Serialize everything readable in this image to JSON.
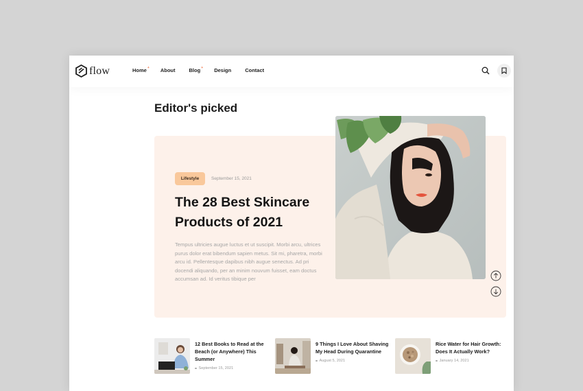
{
  "brand": {
    "name": "flow"
  },
  "nav": {
    "items": [
      {
        "label": "Home",
        "sup": "+"
      },
      {
        "label": "About",
        "sup": ""
      },
      {
        "label": "Blog",
        "sup": "+"
      },
      {
        "label": "Design",
        "sup": ""
      },
      {
        "label": "Contact",
        "sup": ""
      }
    ]
  },
  "section": {
    "title": "Editor's picked"
  },
  "hero": {
    "category": "Lifestyle",
    "date": "September 15, 2021",
    "title": "The 28 Best Skincare Products of 2021",
    "excerpt": "Tempus ultricies augue luctus et ut suscipit. Morbi arcu, ultrices purus dolor erat bibendum sapien metus. Sit mi, pharetra, morbi arcu id. Pellentesque dapibus nibh augue senectus. Ad pri docendi aliquando, per an minim nouvum fuisset, eam doctus accumsan ad. Id veritus tibique per"
  },
  "posts": [
    {
      "title": "12 Best Books to Read at the Beach (or Anywhere) This Summer",
      "date": "September 15, 2021"
    },
    {
      "title": "9 Things I Love About Shaving My Head During Quarantine",
      "date": "August 5, 2021"
    },
    {
      "title": "Rice Water for Hair Growth: Does It Actually Work?",
      "date": "January 14, 2021"
    }
  ],
  "colors": {
    "accent": "#f07a50",
    "badge": "#f9c89b",
    "card": "#fdf1ea"
  }
}
